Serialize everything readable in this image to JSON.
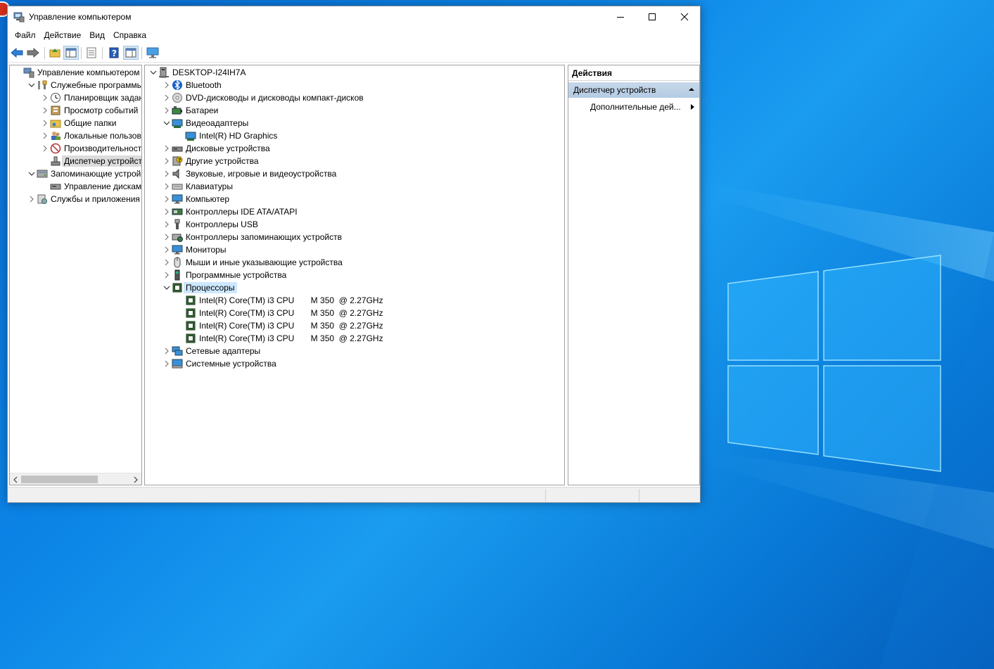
{
  "window": {
    "title": "Управление компьютером",
    "menu": [
      "Файл",
      "Действие",
      "Вид",
      "Справка"
    ]
  },
  "left_tree": [
    {
      "label": "Управление компьютером (л",
      "level": 0,
      "expander": "none",
      "icon": "computer-management-icon"
    },
    {
      "label": "Служебные программы",
      "level": 1,
      "expander": "expanded",
      "icon": "tools-icon"
    },
    {
      "label": "Планировщик заданий",
      "level": 2,
      "expander": "collapsed",
      "icon": "clock-icon"
    },
    {
      "label": "Просмотр событий",
      "level": 2,
      "expander": "collapsed",
      "icon": "event-viewer-icon"
    },
    {
      "label": "Общие папки",
      "level": 2,
      "expander": "collapsed",
      "icon": "shared-folder-icon"
    },
    {
      "label": "Локальные пользовате",
      "level": 2,
      "expander": "collapsed",
      "icon": "users-icon"
    },
    {
      "label": "Производительность",
      "level": 2,
      "expander": "collapsed",
      "icon": "performance-icon"
    },
    {
      "label": "Диспетчер устройств",
      "level": 2,
      "expander": "none",
      "icon": "device-manager-icon",
      "selected": true
    },
    {
      "label": "Запоминающие устройст",
      "level": 1,
      "expander": "expanded",
      "icon": "storage-icon"
    },
    {
      "label": "Управление дисками",
      "level": 2,
      "expander": "none",
      "icon": "disk-management-icon"
    },
    {
      "label": "Службы и приложения",
      "level": 1,
      "expander": "collapsed",
      "icon": "services-icon"
    }
  ],
  "device_tree": [
    {
      "label": "DESKTOP-I24IH7A",
      "level": 0,
      "expander": "expanded",
      "icon": "computer-icon"
    },
    {
      "label": "Bluetooth",
      "level": 1,
      "expander": "collapsed",
      "icon": "bluetooth-icon"
    },
    {
      "label": "DVD-дисководы и дисководы компакт-дисков",
      "level": 1,
      "expander": "collapsed",
      "icon": "dvd-icon"
    },
    {
      "label": "Батареи",
      "level": 1,
      "expander": "collapsed",
      "icon": "battery-icon"
    },
    {
      "label": "Видеоадаптеры",
      "level": 1,
      "expander": "expanded",
      "icon": "display-adapter-icon"
    },
    {
      "label": "Intel(R) HD Graphics",
      "level": 2,
      "expander": "none",
      "icon": "display-adapter-icon"
    },
    {
      "label": "Дисковые устройства",
      "level": 1,
      "expander": "collapsed",
      "icon": "disk-drive-icon"
    },
    {
      "label": "Другие устройства",
      "level": 1,
      "expander": "collapsed",
      "icon": "unknown-device-icon"
    },
    {
      "label": "Звуковые, игровые и видеоустройства",
      "level": 1,
      "expander": "collapsed",
      "icon": "speaker-icon"
    },
    {
      "label": "Клавиатуры",
      "level": 1,
      "expander": "collapsed",
      "icon": "keyboard-icon"
    },
    {
      "label": "Компьютер",
      "level": 1,
      "expander": "collapsed",
      "icon": "monitor-icon"
    },
    {
      "label": "Контроллеры IDE ATA/ATAPI",
      "level": 1,
      "expander": "collapsed",
      "icon": "ide-controller-icon"
    },
    {
      "label": "Контроллеры USB",
      "level": 1,
      "expander": "collapsed",
      "icon": "usb-icon"
    },
    {
      "label": "Контроллеры запоминающих устройств",
      "level": 1,
      "expander": "collapsed",
      "icon": "storage-controller-icon"
    },
    {
      "label": "Мониторы",
      "level": 1,
      "expander": "collapsed",
      "icon": "monitor-icon"
    },
    {
      "label": "Мыши и иные указывающие устройства",
      "level": 1,
      "expander": "collapsed",
      "icon": "mouse-icon"
    },
    {
      "label": "Программные устройства",
      "level": 1,
      "expander": "collapsed",
      "icon": "software-device-icon"
    },
    {
      "label": "Процессоры",
      "level": 1,
      "expander": "expanded",
      "icon": "processor-icon",
      "selected": true
    },
    {
      "label": "Intel(R) Core(TM) i3 CPU       M 350  @ 2.27GHz",
      "level": 2,
      "expander": "none",
      "icon": "processor-icon"
    },
    {
      "label": "Intel(R) Core(TM) i3 CPU       M 350  @ 2.27GHz",
      "level": 2,
      "expander": "none",
      "icon": "processor-icon"
    },
    {
      "label": "Intel(R) Core(TM) i3 CPU       M 350  @ 2.27GHz",
      "level": 2,
      "expander": "none",
      "icon": "processor-icon"
    },
    {
      "label": "Intel(R) Core(TM) i3 CPU       M 350  @ 2.27GHz",
      "level": 2,
      "expander": "none",
      "icon": "processor-icon"
    },
    {
      "label": "Сетевые адаптеры",
      "level": 1,
      "expander": "collapsed",
      "icon": "network-adapter-icon"
    },
    {
      "label": "Системные устройства",
      "level": 1,
      "expander": "collapsed",
      "icon": "system-device-icon"
    }
  ],
  "actions": {
    "header": "Действия",
    "section": "Диспетчер устройств",
    "item": "Дополнительные дей..."
  },
  "colors": {
    "desktop": "#0b84e6",
    "selection": "#cce8ff",
    "actions_section": "#b4cbe3"
  }
}
